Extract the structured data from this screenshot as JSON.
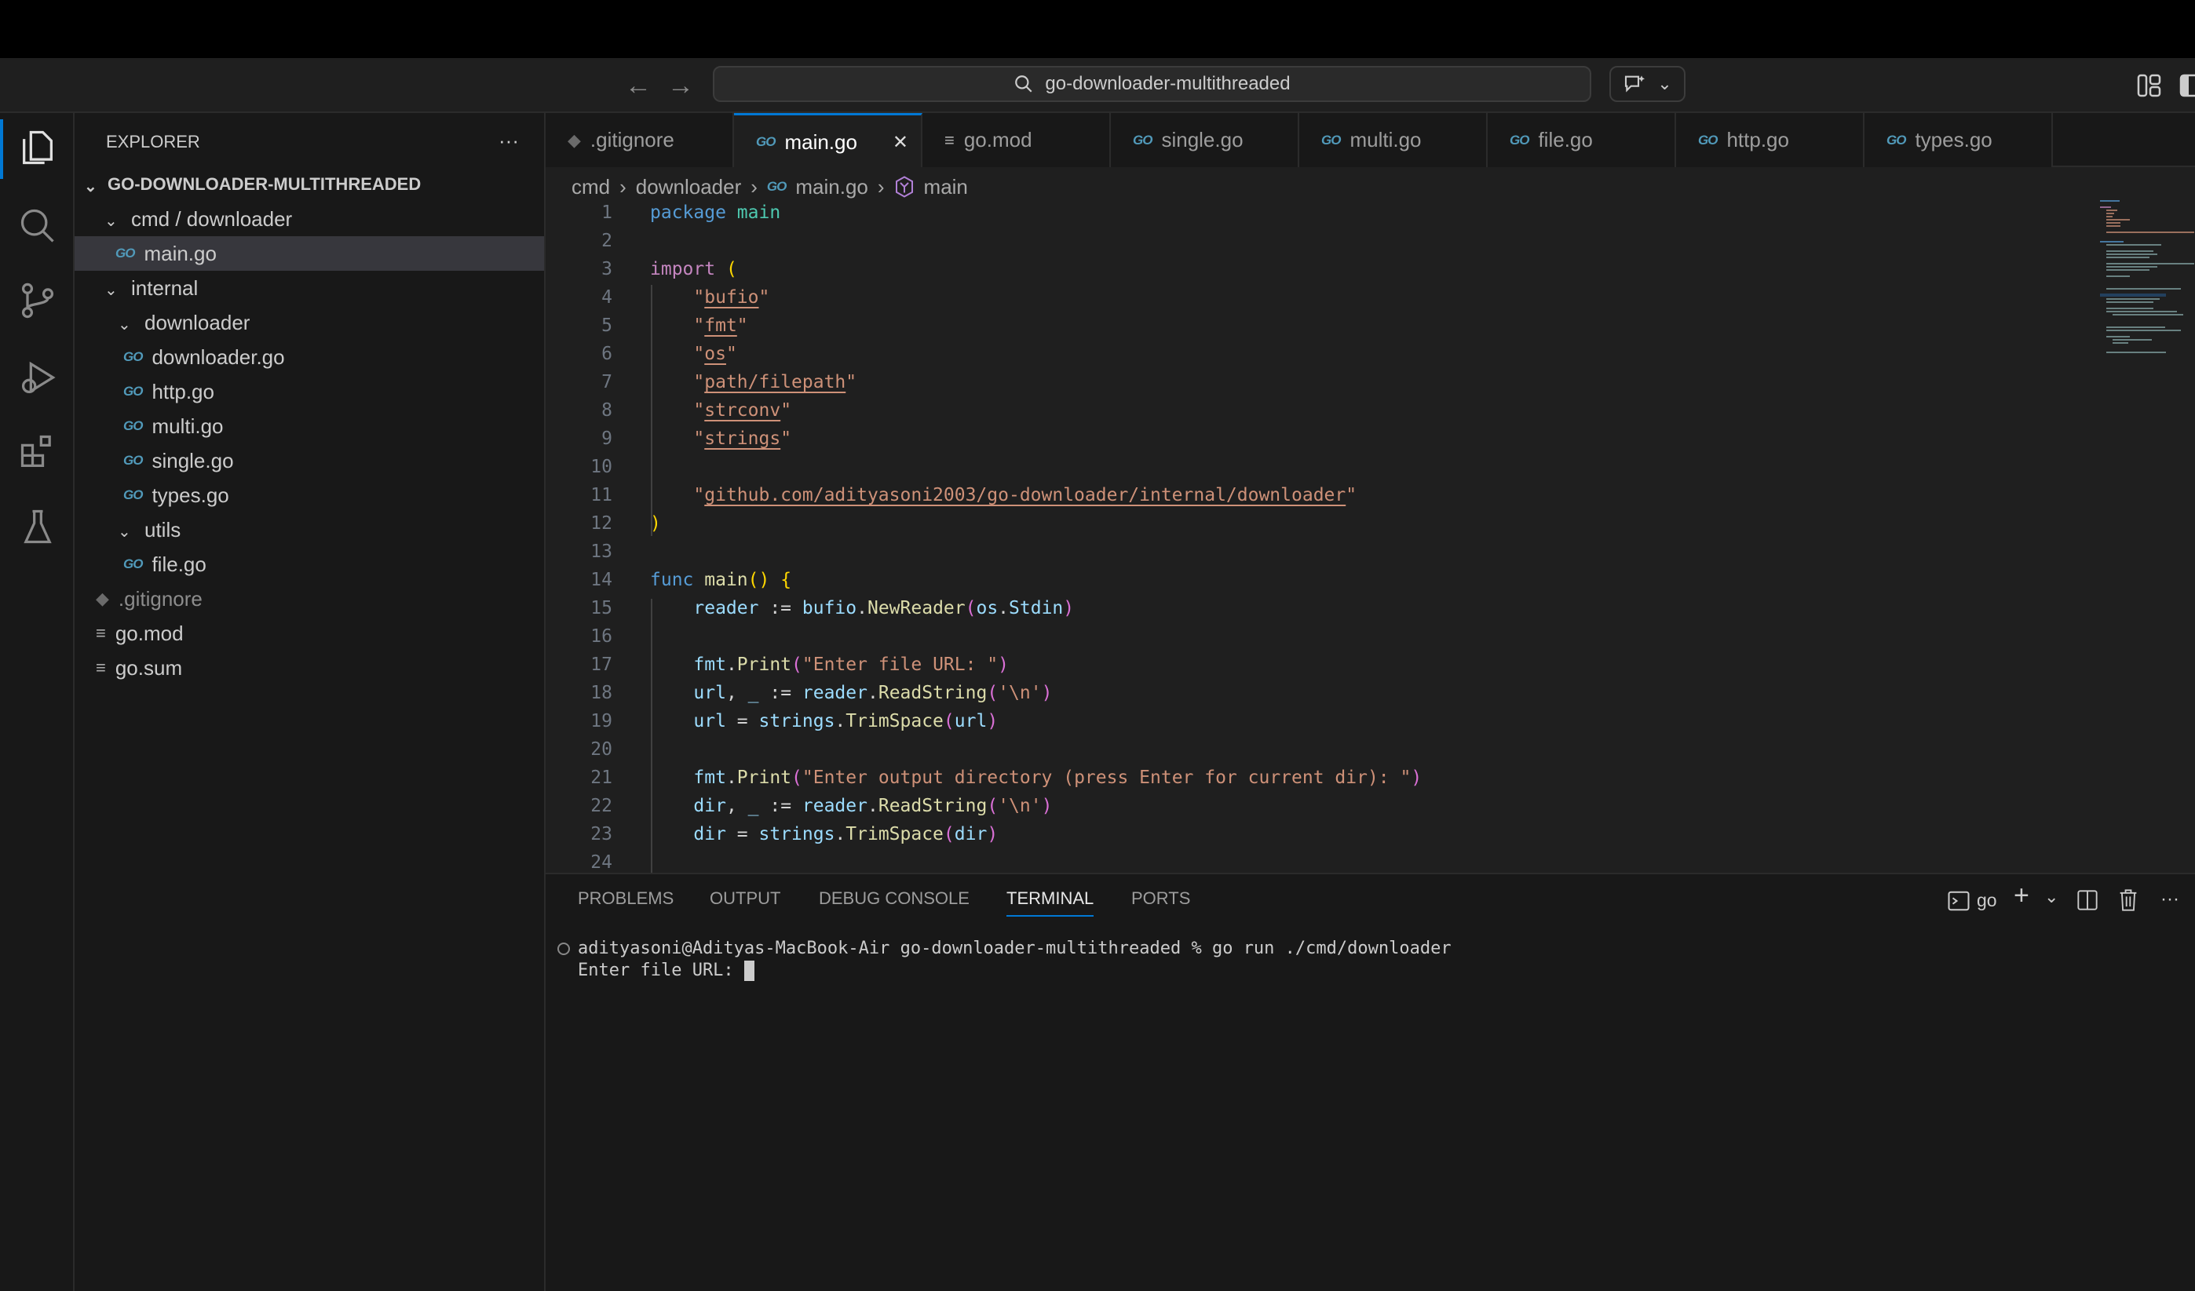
{
  "title": {
    "search": "go-downloader-multithreaded"
  },
  "explorer": {
    "header": "EXPLORER",
    "more": "···",
    "project": "GO-DOWNLOADER-MULTITHREADED",
    "items": [
      {
        "label": "cmd / downloader",
        "type": "folder",
        "depth": 0
      },
      {
        "label": "main.go",
        "type": "go",
        "depth": 1,
        "selected": true
      },
      {
        "label": "internal",
        "type": "folder",
        "depth": 0
      },
      {
        "label": "downloader",
        "type": "folder",
        "depth": 1
      },
      {
        "label": "downloader.go",
        "type": "go",
        "depth": 2
      },
      {
        "label": "http.go",
        "type": "go",
        "depth": 2
      },
      {
        "label": "multi.go",
        "type": "go",
        "depth": 2
      },
      {
        "label": "single.go",
        "type": "go",
        "depth": 2
      },
      {
        "label": "types.go",
        "type": "go",
        "depth": 2
      },
      {
        "label": "utils",
        "type": "folder",
        "depth": 1
      },
      {
        "label": "file.go",
        "type": "go",
        "depth": 2
      },
      {
        "label": ".gitignore",
        "type": "git",
        "depth": 0
      },
      {
        "label": "go.mod",
        "type": "file",
        "depth": 0
      },
      {
        "label": "go.sum",
        "type": "file",
        "depth": 0
      }
    ]
  },
  "tabs": [
    {
      "label": ".gitignore",
      "type": "git"
    },
    {
      "label": "main.go",
      "type": "go",
      "active": true
    },
    {
      "label": "go.mod",
      "type": "file"
    },
    {
      "label": "single.go",
      "type": "go"
    },
    {
      "label": "multi.go",
      "type": "go"
    },
    {
      "label": "file.go",
      "type": "go"
    },
    {
      "label": "http.go",
      "type": "go"
    },
    {
      "label": "types.go",
      "type": "go"
    }
  ],
  "go_icon": "GO",
  "breadcrumb": [
    "cmd",
    "downloader",
    "main.go",
    "main"
  ],
  "code": [
    [
      [
        "package ",
        "kw"
      ],
      [
        "main",
        "pkg"
      ]
    ],
    [],
    [
      [
        "import ",
        "kw2"
      ],
      [
        "(",
        "b1"
      ]
    ],
    [
      [
        "    \"",
        ""
      ],
      [
        "bufio",
        "str u"
      ],
      [
        "\"",
        "str"
      ]
    ],
    [
      [
        "    \"",
        ""
      ],
      [
        "fmt",
        "str u"
      ],
      [
        "\"",
        "str"
      ]
    ],
    [
      [
        "    \"",
        ""
      ],
      [
        "os",
        "str u"
      ],
      [
        "\"",
        "str"
      ]
    ],
    [
      [
        "    \"",
        ""
      ],
      [
        "path/filepath",
        "str u"
      ],
      [
        "\"",
        "str"
      ]
    ],
    [
      [
        "    \"",
        ""
      ],
      [
        "strconv",
        "str u"
      ],
      [
        "\"",
        "str"
      ]
    ],
    [
      [
        "    \"",
        ""
      ],
      [
        "strings",
        "str u"
      ],
      [
        "\"",
        "str"
      ]
    ],
    [],
    [
      [
        "    \"",
        ""
      ],
      [
        "github.com/adityasoni2003/go-downloader/internal/downloader",
        "str u"
      ],
      [
        "\"",
        "str"
      ]
    ],
    [
      [
        ")",
        "b1"
      ]
    ],
    [],
    [
      [
        "func ",
        "kw"
      ],
      [
        "main",
        "fn"
      ],
      [
        "() ",
        "b1"
      ],
      [
        "{",
        "b1"
      ]
    ],
    [
      [
        "    reader",
        "var"
      ],
      [
        " := ",
        ""
      ],
      [
        "bufio",
        "var"
      ],
      [
        ".",
        ""
      ],
      [
        "NewReader",
        "fn"
      ],
      [
        "(",
        "b2"
      ],
      [
        "os",
        "var"
      ],
      [
        ".",
        ""
      ],
      [
        "Stdin",
        "var"
      ],
      [
        ")",
        "b2"
      ]
    ],
    [],
    [
      [
        "    fmt",
        "var"
      ],
      [
        ".",
        ""
      ],
      [
        "Print",
        "fn"
      ],
      [
        "(",
        "b2"
      ],
      [
        "\"Enter file URL: \"",
        "str"
      ],
      [
        ")",
        "b2"
      ]
    ],
    [
      [
        "    url",
        "var"
      ],
      [
        ", ",
        ""
      ],
      [
        "_",
        "var"
      ],
      [
        " := ",
        ""
      ],
      [
        "reader",
        "var"
      ],
      [
        ".",
        ""
      ],
      [
        "ReadString",
        "fn"
      ],
      [
        "(",
        "b2"
      ],
      [
        "'\\n'",
        "str"
      ],
      [
        ")",
        "b2"
      ]
    ],
    [
      [
        "    url",
        "var"
      ],
      [
        " = ",
        ""
      ],
      [
        "strings",
        "var"
      ],
      [
        ".",
        ""
      ],
      [
        "TrimSpace",
        "fn"
      ],
      [
        "(",
        "b2"
      ],
      [
        "url",
        "var"
      ],
      [
        ")",
        "b2"
      ]
    ],
    [],
    [
      [
        "    fmt",
        "var"
      ],
      [
        ".",
        ""
      ],
      [
        "Print",
        "fn"
      ],
      [
        "(",
        "b2"
      ],
      [
        "\"Enter output directory (press Enter for current dir): \"",
        "str"
      ],
      [
        ")",
        "b2"
      ]
    ],
    [
      [
        "    dir",
        "var"
      ],
      [
        ", ",
        ""
      ],
      [
        "_",
        "var"
      ],
      [
        " := ",
        ""
      ],
      [
        "reader",
        "var"
      ],
      [
        ".",
        ""
      ],
      [
        "ReadString",
        "fn"
      ],
      [
        "(",
        "b2"
      ],
      [
        "'\\n'",
        "str"
      ],
      [
        ")",
        "b2"
      ]
    ],
    [
      [
        "    dir",
        "var"
      ],
      [
        " = ",
        ""
      ],
      [
        "strings",
        "var"
      ],
      [
        ".",
        ""
      ],
      [
        "TrimSpace",
        "fn"
      ],
      [
        "(",
        "b2"
      ],
      [
        "dir",
        "var"
      ],
      [
        ")",
        "b2"
      ]
    ],
    []
  ],
  "panel": {
    "tabs": [
      "PROBLEMS",
      "OUTPUT",
      "DEBUG CONSOLE",
      "TERMINAL",
      "PORTS"
    ],
    "active": "TERMINAL",
    "shell": "go",
    "more": "···"
  },
  "terminal": {
    "line1": "adityasoni@Adityas-MacBook-Air go-downloader-multithreaded % go run ./cmd/downloader",
    "line2": "Enter file URL: "
  }
}
